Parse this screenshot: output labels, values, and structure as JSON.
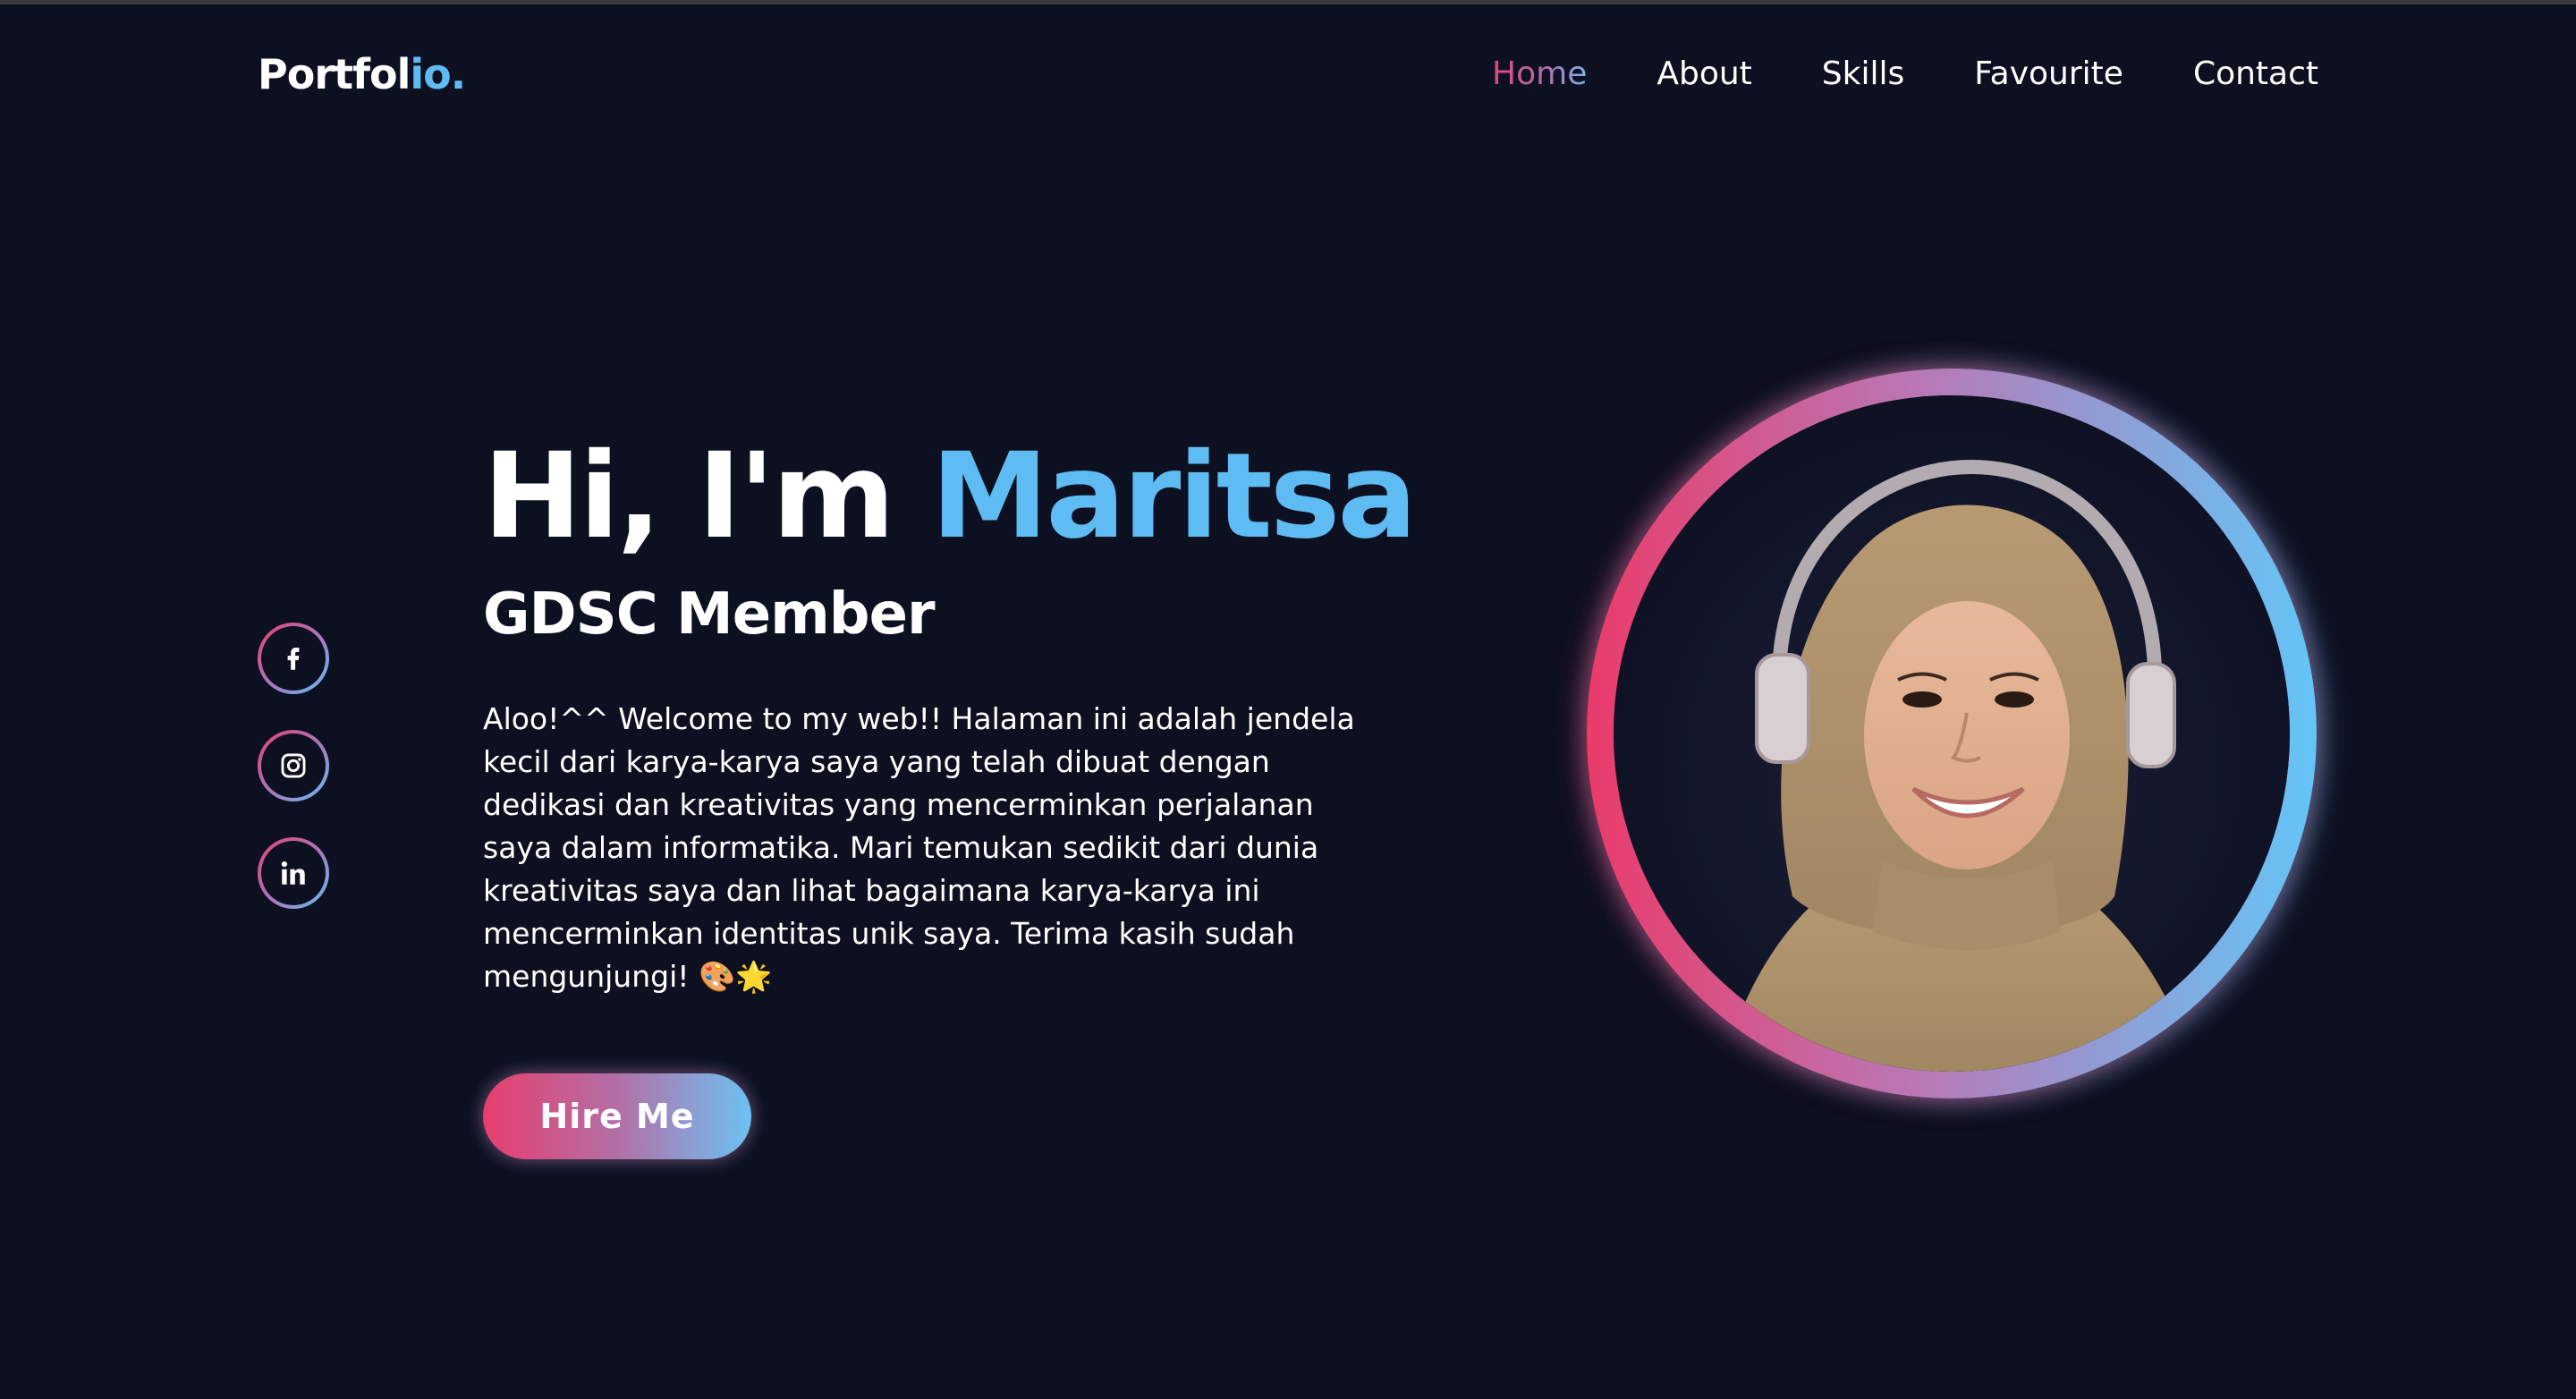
{
  "header": {
    "logo_main": "Portfol",
    "logo_accent": "io.",
    "nav": [
      {
        "label": "Home",
        "active": true
      },
      {
        "label": "About",
        "active": false
      },
      {
        "label": "Skills",
        "active": false
      },
      {
        "label": "Favourite",
        "active": false
      },
      {
        "label": "Contact",
        "active": false
      }
    ]
  },
  "socials": [
    {
      "icon": "facebook-icon"
    },
    {
      "icon": "instagram-icon"
    },
    {
      "icon": "linkedin-icon"
    }
  ],
  "hero": {
    "greeting": "Hi, I'm",
    "name": "Maritsa",
    "role": "GDSC Member",
    "description": "Aloo!^^ Welcome to my web!! Halaman ini adalah jendela kecil dari karya-karya saya yang telah dibuat dengan dedikasi dan kreativitas yang mencerminkan perjalanan saya dalam informatika. Mari temukan sedikit dari dunia kreativitas saya dan lihat bagaimana karya-karya ini mencerminkan identitas unik saya. Terima kasih sudah mengunjungi! 🎨🌟",
    "cta_label": "Hire Me"
  },
  "colors": {
    "background": "#0d1021",
    "accent_blue": "#5ebcf2",
    "accent_pink": "#e83f6e"
  }
}
